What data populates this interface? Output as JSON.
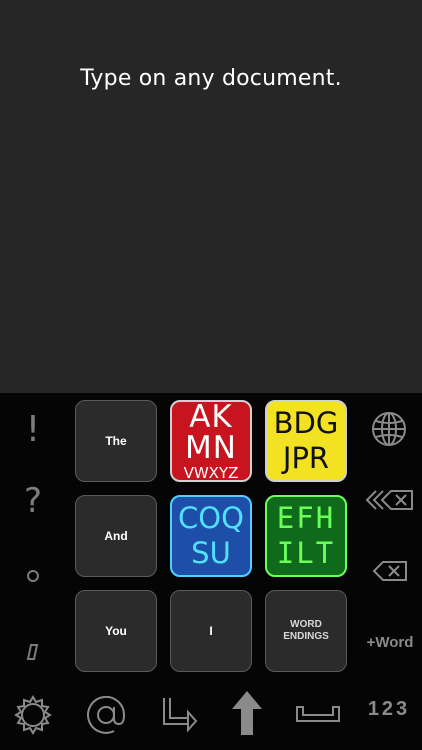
{
  "caption": "Type on any document.",
  "side_left": {
    "exclaim": "!",
    "question": "?",
    "period": "•",
    "comma": "/"
  },
  "word_keys": {
    "the": "The",
    "and": "And",
    "you": "You",
    "i": "I",
    "endings_line1": "WORD",
    "endings_line2": "ENDINGS"
  },
  "letter_keys": {
    "red": {
      "line1": "AK",
      "line2": "MN",
      "line3": "VWXYZ"
    },
    "yellow": {
      "line1": "BDG",
      "line2": "JPR"
    },
    "blue": {
      "line1": "COQ",
      "line2": "SU"
    },
    "green": {
      "line1": "EFH",
      "line2": "ILT"
    }
  },
  "side_right": {
    "plus_word": "+Word"
  },
  "bottom": {
    "numbers": "123"
  },
  "colors": {
    "red_key": "#c8141e",
    "yellow_key": "#f3e221",
    "blue_key": "#1d4fa8",
    "green_key": "#0f6a1c"
  }
}
